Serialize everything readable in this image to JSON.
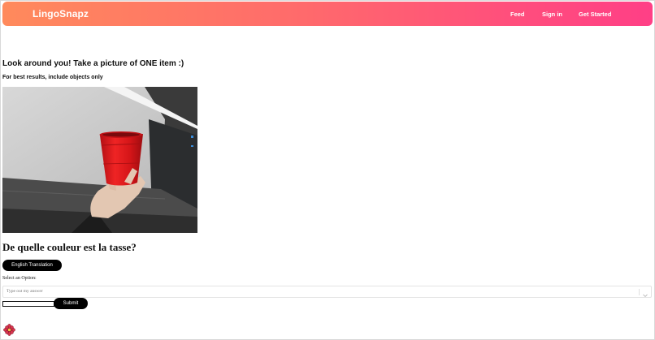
{
  "navbar": {
    "brand": "LingoSnapz",
    "links": [
      {
        "label": "Feed"
      },
      {
        "label": "Sign in"
      },
      {
        "label": "Get Started"
      }
    ]
  },
  "main": {
    "heading": "Look around you! Take a picture of ONE item :)",
    "subheading": "For best results, include objects only",
    "question": "De quelle couleur est la tasse?",
    "translate_button": "English Translation",
    "select_label": "Select an Option:",
    "select_placeholder": "Type out my answer",
    "answer_input_value": "",
    "submit_button": "Submit"
  },
  "colors": {
    "gradient_start": "#ff8a5c",
    "gradient_end": "#ff3f86",
    "button_bg": "#000000",
    "cup_red": "#e01818"
  },
  "icons": {
    "select_chevron": "chevron-down-icon",
    "bottom_icon": "flower-icon"
  }
}
